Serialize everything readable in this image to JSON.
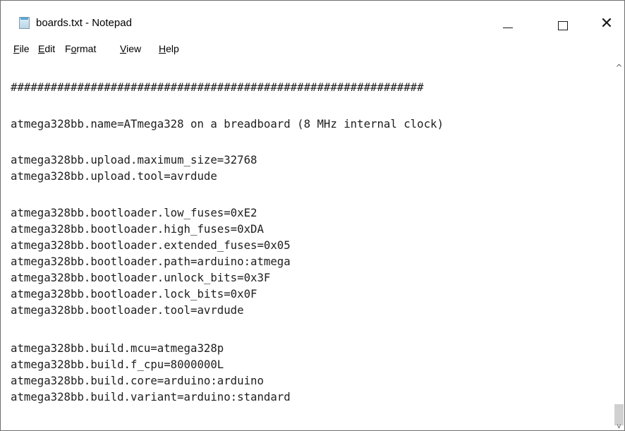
{
  "window": {
    "title": "boards.txt - Notepad",
    "icon": "notepad-icon",
    "controls": {
      "minimize_icon": "minimize-icon",
      "maximize_icon": "maximize-icon",
      "close_icon": "close-icon",
      "close_glyph": "✕"
    }
  },
  "menu": {
    "file": {
      "mnemonic": "F",
      "rest": "ile"
    },
    "edit": {
      "mnemonic": "E",
      "rest": "dit"
    },
    "format": {
      "start": "F",
      "mnemonic": "o",
      "rest": "rmat"
    },
    "view": {
      "mnemonic": "V",
      "rest": "iew"
    },
    "help": {
      "mnemonic": "H",
      "rest": "elp"
    }
  },
  "editor": {
    "lines": [
      "##############################################################",
      "",
      "atmega328bb.name=ATmega328 on a breadboard (8 MHz internal clock)",
      "",
      "atmega328bb.upload.maximum_size=32768",
      "atmega328bb.upload.tool=avrdude",
      "",
      "atmega328bb.bootloader.low_fuses=0xE2",
      "atmega328bb.bootloader.high_fuses=0xDA",
      "atmega328bb.bootloader.extended_fuses=0x05",
      "atmega328bb.bootloader.path=arduino:atmega",
      "atmega328bb.bootloader.unlock_bits=0x3F",
      "atmega328bb.bootloader.lock_bits=0x0F",
      "atmega328bb.bootloader.tool=avrdude",
      "",
      "atmega328bb.build.mcu=atmega328p",
      "atmega328bb.build.f_cpu=8000000L",
      "atmega328bb.build.core=arduino:arduino",
      "atmega328bb.build.variant=arduino:standard"
    ]
  },
  "scrollbar": {
    "up_glyph": "^",
    "down_glyph": "v",
    "up_icon": "scroll-up-arrow-icon",
    "down_icon": "scroll-down-arrow-icon"
  }
}
